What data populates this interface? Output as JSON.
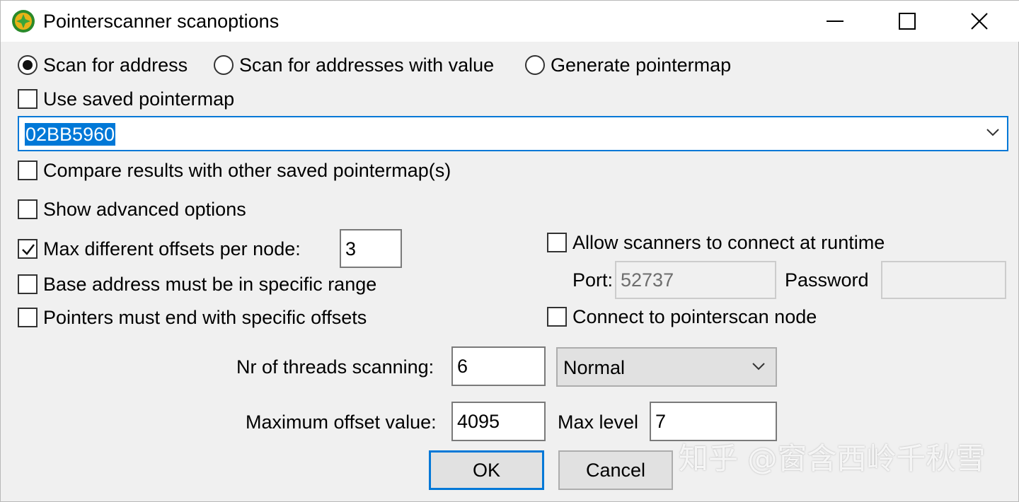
{
  "window": {
    "title": "Pointerscanner scanoptions",
    "controls": {
      "minimize": "minimize",
      "maximize": "maximize",
      "close": "close"
    }
  },
  "scan_mode": {
    "options": [
      {
        "label": "Scan for address",
        "selected": true
      },
      {
        "label": "Scan for addresses with value",
        "selected": false
      },
      {
        "label": "Generate pointermap",
        "selected": false
      }
    ]
  },
  "use_saved_pointermap": {
    "label": "Use saved pointermap",
    "checked": false
  },
  "address_combo": {
    "value": "02BB5960"
  },
  "compare_results": {
    "label": "Compare results with other saved pointermap(s)",
    "checked": false
  },
  "show_advanced": {
    "label": "Show advanced options",
    "checked": false
  },
  "max_offsets": {
    "label": "Max different offsets per node:",
    "checked": true,
    "value": "3"
  },
  "base_address_range": {
    "label": "Base address must be in specific range",
    "checked": false
  },
  "pointers_end_offsets": {
    "label": "Pointers must end with specific offsets",
    "checked": false
  },
  "allow_scanners": {
    "label": "Allow scanners to connect at runtime",
    "checked": false
  },
  "port": {
    "label": "Port:",
    "value": "52737"
  },
  "password": {
    "label": "Password",
    "value": ""
  },
  "connect_node": {
    "label": "Connect to pointerscan node",
    "checked": false
  },
  "threads": {
    "label": "Nr of threads scanning:",
    "value": "6",
    "priority": "Normal"
  },
  "max_offset_value": {
    "label": "Maximum offset value:",
    "value": "4095"
  },
  "max_level": {
    "label": "Max level",
    "value": "7"
  },
  "buttons": {
    "ok": "OK",
    "cancel": "Cancel"
  },
  "watermark": "知乎 @窗含西岭千秋雪",
  "colors": {
    "accent": "#0078d7",
    "background": "#f0f0f0",
    "button": "#e1e1e1"
  },
  "icons": {
    "app": "cheat-engine-icon",
    "dropdown": "chevron-down-icon",
    "check": "checkmark-icon"
  }
}
